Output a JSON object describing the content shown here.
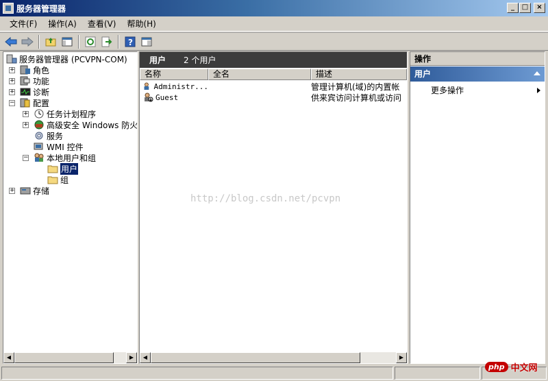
{
  "window": {
    "title": "服务器管理器"
  },
  "menu": [
    "文件(F)",
    "操作(A)",
    "查看(V)",
    "帮助(H)"
  ],
  "tree": {
    "root": "服务器管理器 (PCVPN-COM)",
    "items": [
      {
        "label": "角色",
        "icon": "roles-icon",
        "expander": "+"
      },
      {
        "label": "功能",
        "icon": "features-icon",
        "expander": "+"
      },
      {
        "label": "诊断",
        "icon": "diagnostics-icon",
        "expander": "+"
      },
      {
        "label": "配置",
        "icon": "configuration-icon",
        "expander": "−"
      },
      {
        "label": "任务计划程序",
        "icon": "clock-icon",
        "expander": "+"
      },
      {
        "label": "高级安全 Windows 防火墙",
        "icon": "firewall-icon",
        "expander": "+"
      },
      {
        "label": "服务",
        "icon": "gear-icon",
        "expander": ""
      },
      {
        "label": "WMI 控件",
        "icon": "wmi-icon",
        "expander": ""
      },
      {
        "label": "本地用户和组",
        "icon": "users-group-icon",
        "expander": "−"
      },
      {
        "label": "用户",
        "icon": "folder-icon",
        "expander": ""
      },
      {
        "label": "组",
        "icon": "folder-icon",
        "expander": ""
      },
      {
        "label": "存储",
        "icon": "storage-icon",
        "expander": "+"
      }
    ]
  },
  "list": {
    "title": "用户",
    "count": "2 个用户",
    "columns": [
      "名称",
      "全名",
      "描述"
    ],
    "rows": [
      {
        "name": "Administr...",
        "fullname": "",
        "desc": "管理计算机(域)的内置帐"
      },
      {
        "name": "Guest",
        "fullname": "",
        "desc": "供来宾访问计算机或访问"
      }
    ]
  },
  "actions": {
    "title": "操作",
    "section": "用户",
    "item": "更多操作"
  },
  "watermark": "http://blog.csdn.net/pcvpn",
  "logo": {
    "php": "php",
    "cn": "中文网"
  },
  "colors": {
    "selection": "#0a246a",
    "titlebar": "#0a246a",
    "section": "#2f5b9a"
  }
}
